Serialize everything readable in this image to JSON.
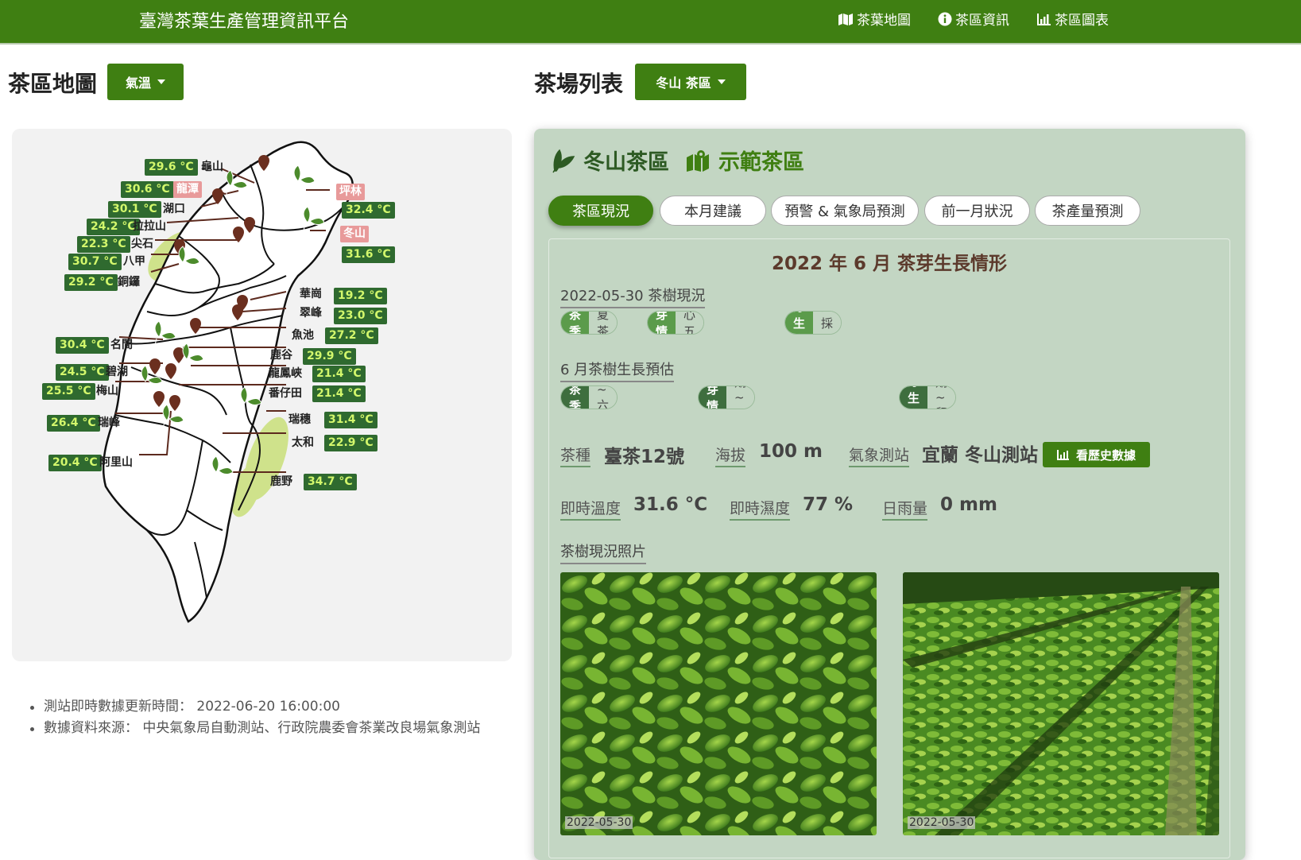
{
  "nav": {
    "brand": "臺灣茶葉生產管理資訊平台",
    "links": [
      {
        "label": "茶葉地圖",
        "icon": "map-icon"
      },
      {
        "label": "茶區資訊",
        "icon": "info-icon"
      },
      {
        "label": "茶區圖表",
        "icon": "bar-chart-icon"
      }
    ]
  },
  "map_section": {
    "title": "茶區地圖",
    "layer_dropdown": "氣溫",
    "stations": [
      {
        "name": "龜山",
        "temp": "29.6 °C",
        "highlight": false
      },
      {
        "name": "龍潭",
        "temp": "30.6 °C",
        "highlight": true
      },
      {
        "name": "湖口",
        "temp": "30.1 °C",
        "highlight": false
      },
      {
        "name": "拉拉山",
        "temp": "24.2 °C",
        "highlight": false
      },
      {
        "name": "尖石",
        "temp": "22.3 °C",
        "highlight": false
      },
      {
        "name": "八甲",
        "temp": "30.7 °C",
        "highlight": false
      },
      {
        "name": "銅鑼",
        "temp": "29.2 °C",
        "highlight": false
      },
      {
        "name": "坪林",
        "temp": "32.4 °C",
        "highlight": true
      },
      {
        "name": "冬山",
        "temp": "31.6 °C",
        "highlight": true
      },
      {
        "name": "華崗",
        "temp": "19.2 °C",
        "highlight": false
      },
      {
        "name": "翠峰",
        "temp": "23.0 °C",
        "highlight": false
      },
      {
        "name": "魚池",
        "temp": "27.2 °C",
        "highlight": false
      },
      {
        "name": "鹿谷",
        "temp": "29.9 °C",
        "highlight": false
      },
      {
        "name": "龍鳳峽",
        "temp": "21.4 °C",
        "highlight": false
      },
      {
        "name": "番仔田",
        "temp": "21.4 °C",
        "highlight": false
      },
      {
        "name": "名間",
        "temp": "30.4 °C",
        "highlight": false
      },
      {
        "name": "碧湖",
        "temp": "24.5 °C",
        "highlight": false
      },
      {
        "name": "梅山",
        "temp": "25.5 °C",
        "highlight": false
      },
      {
        "name": "瑞峰",
        "temp": "26.4 °C",
        "highlight": false
      },
      {
        "name": "阿里山",
        "temp": "20.4 °C",
        "highlight": false
      },
      {
        "name": "瑞穗",
        "temp": "31.4 °C",
        "highlight": false
      },
      {
        "name": "太和",
        "temp": "22.9 °C",
        "highlight": false
      },
      {
        "name": "鹿野",
        "temp": "34.7 °C",
        "highlight": false
      }
    ],
    "notes": [
      "測站即時數據更新時間： 2022-06-20 16:00:00",
      "數據資料來源： 中央氣象局自動測站、行政院農委會茶業改良場氣象測站"
    ]
  },
  "farm_section": {
    "title": "茶場列表",
    "area_dropdown": "冬山 茶區",
    "area_name": "冬山茶區",
    "area_badge": "示範茶區",
    "tabs": [
      "茶區現況",
      "本月建議",
      "預警 & 氣象局預測",
      "前一月狀況",
      "茶產量預測"
    ],
    "active_tab": "茶區現況",
    "month_title": "2022 年 6 月 茶芽生長情形",
    "current": {
      "label": "2022-05-30 茶樹現況",
      "season_k": "茶季",
      "season_v": "夏茶",
      "bud_k": "茶芽情形",
      "bud_v": "一心五葉",
      "growth_k": "茶芽生育期",
      "growth_v": "適採期"
    },
    "forecast": {
      "label": "6 月茶樹生長預估",
      "season_k": "茶季",
      "season_v": "夏茶 ~ 六月白",
      "bud_k": "茶芽情形",
      "bud_v": "未萌芽期 ~ 一心三葉",
      "growth_k": "茶芽生育期",
      "growth_v": "留養期 ~ 留養期"
    },
    "info": {
      "variety_l": "茶種",
      "variety_v": "臺茶12號",
      "altitude_l": "海拔",
      "altitude_v": "100 m",
      "station_l": "氣象測站",
      "station_v": "宜蘭 冬山測站",
      "history_button": "看歷史數據",
      "temp_l": "即時溫度",
      "temp_v": "31.6 °C",
      "humid_l": "即時濕度",
      "humid_v": "77 %",
      "rain_l": "日雨量",
      "rain_v": "0 mm"
    },
    "photos_label": "茶樹現況照片",
    "photos": [
      {
        "date": "2022-05-30"
      },
      {
        "date": "2022-05-30"
      }
    ]
  }
}
